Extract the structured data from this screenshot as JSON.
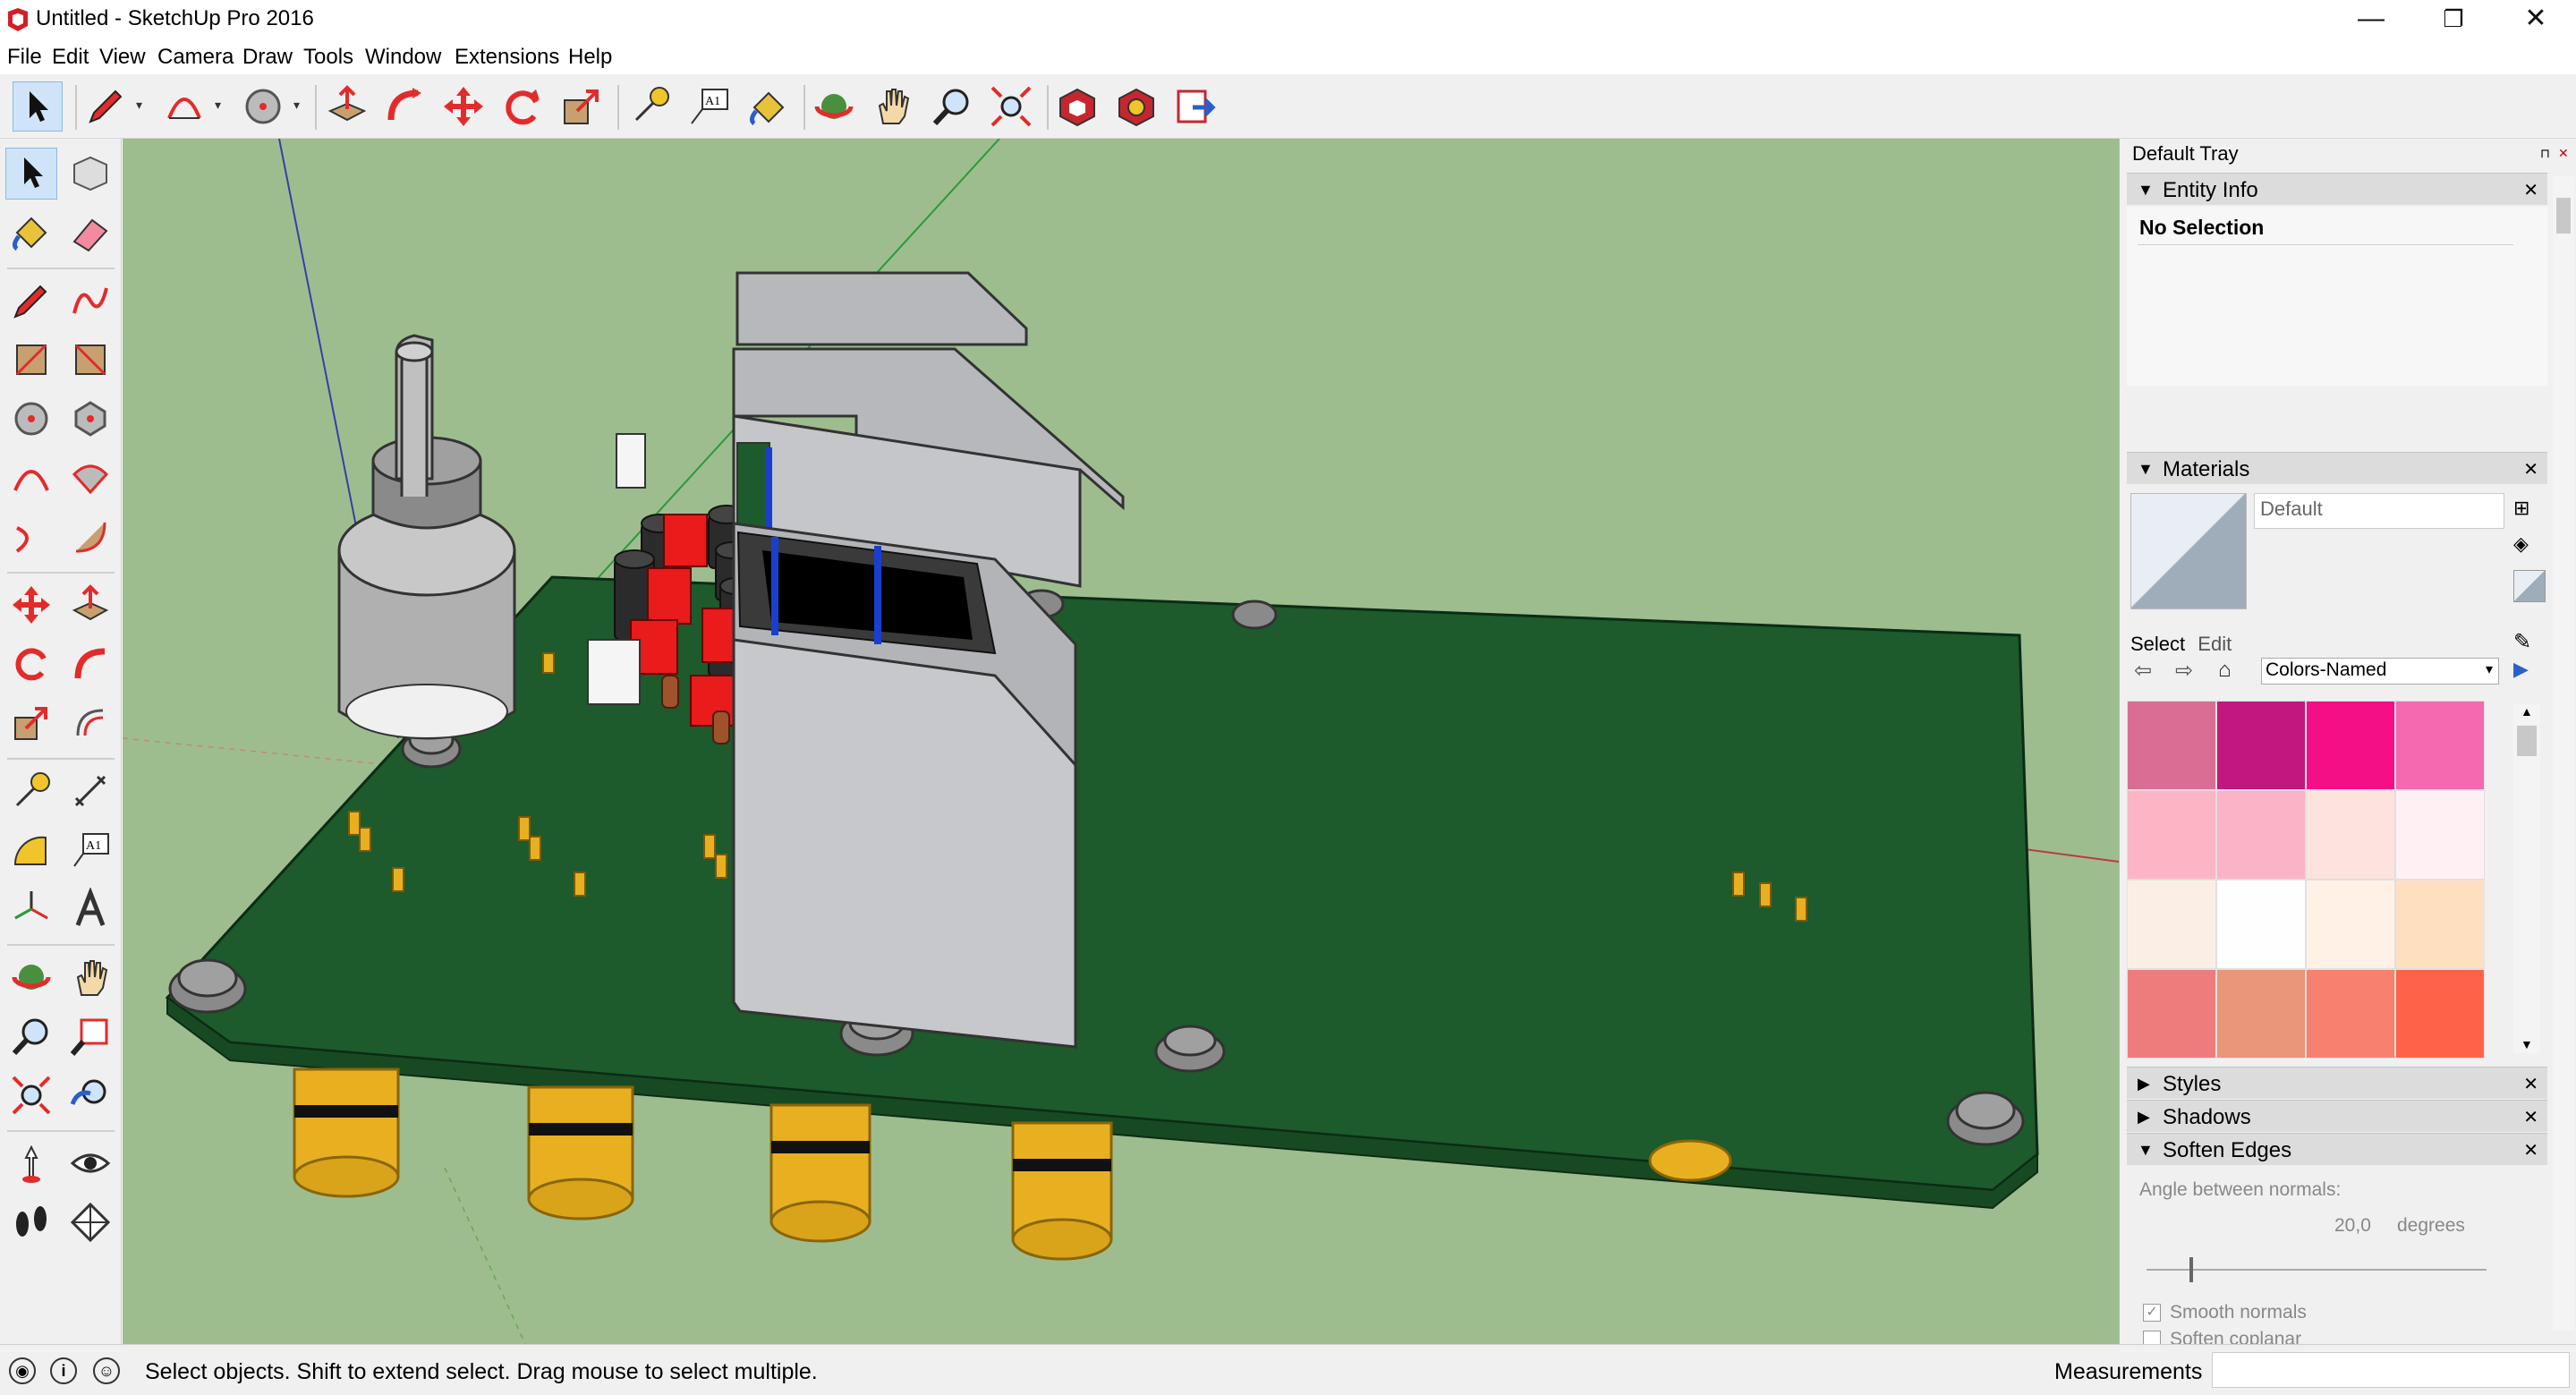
{
  "window": {
    "title": "Untitled - SketchUp Pro 2016",
    "minimize": "—",
    "restore": "❐",
    "close": "✕"
  },
  "menu": [
    "File",
    "Edit",
    "View",
    "Camera",
    "Draw",
    "Tools",
    "Window",
    "Extensions",
    "Help"
  ],
  "toolbar_icons": [
    "select-icon",
    "pencil-icon",
    "arc-icon",
    "circle-icon",
    "push-pull-icon",
    "follow-me-icon",
    "move-icon",
    "rotate-icon",
    "scale-icon",
    "tape-measure-icon",
    "text-icon",
    "paint-bucket-icon",
    "orbit-icon",
    "pan-icon",
    "zoom-icon",
    "zoom-extents-icon",
    "3d-warehouse-icon",
    "extension-warehouse-icon",
    "send-to-layout-icon"
  ],
  "left_toolbar_icons": [
    "select-icon",
    "make-component-icon",
    "paint-bucket-icon",
    "eraser-icon",
    "pencil-icon",
    "freehand-icon",
    "rectangle-icon",
    "rotated-rectangle-icon",
    "circle-icon",
    "polygon-icon",
    "arc-icon",
    "pie-icon",
    "two-point-arc-icon",
    "three-point-arc-icon",
    "move-icon",
    "push-pull-icon",
    "rotate-icon",
    "follow-me-icon",
    "scale-icon",
    "offset-icon",
    "tape-measure-icon",
    "dimension-icon",
    "protractor-icon",
    "text-icon",
    "axes-icon",
    "3d-text-icon",
    "orbit-icon",
    "pan-icon",
    "zoom-icon",
    "zoom-window-icon",
    "zoom-extents-icon",
    "previous-view-icon",
    "position-camera-icon",
    "look-around-icon",
    "walk-icon",
    "section-plane-icon"
  ],
  "tray": {
    "title": "Default Tray",
    "entity_info": {
      "title": "Entity Info",
      "selection": "No Selection"
    },
    "materials": {
      "title": "Materials",
      "material_name": "Default",
      "tab_select": "Select",
      "tab_edit": "Edit",
      "collection": "Colors-Named"
    },
    "swatches": [
      "#d96d94",
      "#c0187e",
      "#f50f86",
      "#f469b0",
      "#fdb4c4",
      "#fbb3c8",
      "#fde2dd",
      "#fef0f3",
      "#fbefe5",
      "#fefefe",
      "#fff1e6",
      "#fee0c0",
      "#ef7c7c",
      "#e9967a",
      "#f8806f",
      "#fe6349"
    ],
    "styles": "Styles",
    "shadows": "Shadows",
    "soften_edges": {
      "title": "Soften Edges",
      "angle_label": "Angle between normals:",
      "angle_value": "20,0",
      "angle_unit": "degrees",
      "smooth": "Smooth normals",
      "coplanar": "Soften coplanar",
      "smooth_checked": true,
      "coplanar_checked": false
    }
  },
  "status": {
    "text": "Select objects. Shift to extend select. Drag mouse to select multiple.",
    "measurements_label": "Measurements",
    "measurements_value": ""
  }
}
